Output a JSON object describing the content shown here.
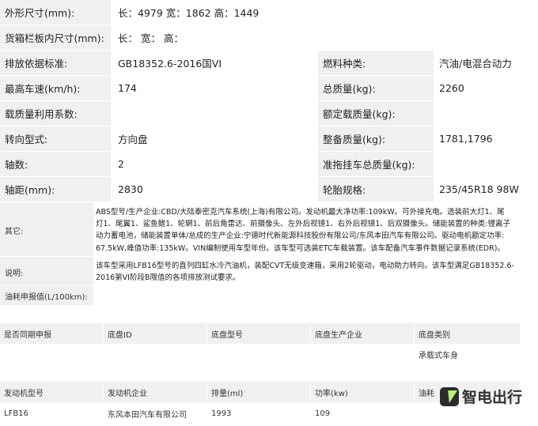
{
  "top": {
    "dimensions_label": "外形尺寸(mm):",
    "dimensions_value": "长：4979 宽：1862 高：1449",
    "cargo_label": "货箱栏板内尺寸(mm):",
    "cargo_value": "长：  宽：  高："
  },
  "rows": [
    {
      "l1": "排放依据标准:",
      "v1": "GB18352.6-2016国VI",
      "l2": "燃料种类:",
      "v2": "汽油/电混合动力"
    },
    {
      "l1": "最高车速(km/h):",
      "v1": "174",
      "l2": "总质量(kg):",
      "v2": "2260"
    },
    {
      "l1": "载质量利用系数:",
      "v1": "",
      "l2": "额定载质量(kg):",
      "v2": ""
    },
    {
      "l1": "转向型式:",
      "v1": "方向盘",
      "l2": "整备质量(kg):",
      "v2": "1781,1796"
    },
    {
      "l1": "轴数:",
      "v1": "2",
      "l2": "准拖挂车总质量(kg):",
      "v2": ""
    },
    {
      "l1": "轴距(mm):",
      "v1": "2830",
      "l2": "轮胎规格:",
      "v2": "235/45R18 98W"
    }
  ],
  "other": {
    "label": "其它:",
    "lines": [
      "ABS型号/生产企业:CBD/大陆泰密克汽车系统(上海)有限公司。发动机最大净功率:109kW。可外接充电。选装前大灯1、尾",
      "灯1、尾翼1、鲨鱼鳍1、轮辋1、前后角雷达、前摄像头、左外后视镜1、右外后视镜1、后双摄像头。储能装置的种类:锂离子",
      "动力蓄电池，储能装置单体/总成的生产企业:宁德时代新能源科技股份有限公司/东风本田汽车有限公司。驱动电机额定功率:",
      "67.5kW,峰值功率:135kW。VIN编制使用车型年份。该车型可选装ETC车载装置。该车配备汽车事件数据记录系统(EDR)。"
    ]
  },
  "note": {
    "label": "说明:",
    "lines": [
      "该车型采用LFB16型号的直列四缸水冷汽油机，装配CVT无级变速箱，采用2轮驱动，电动助力转向。该车型满足GB18352.6-",
      "2016第VI阶段B限值的各项排放测试要求。"
    ]
  },
  "fuel": {
    "label": "油耗申报值(L/100km):",
    "value": ""
  },
  "chassis": {
    "headers": [
      "是否同期申报",
      "底盘ID",
      "底盘型号",
      "底盘生产企业",
      "底盘类别"
    ],
    "row": [
      "",
      "",
      "",
      "",
      "承载式车身"
    ]
  },
  "engine": {
    "headers": [
      "发动机型号",
      "发动机企业",
      "排量(ml)",
      "功率(kw)",
      "油耗"
    ],
    "row": [
      "LFB16",
      "东风本田汽车有限公司",
      "1993",
      "109",
      ""
    ]
  },
  "watermark": {
    "text": "智电出行",
    "icon": "lightning-logo-icon"
  }
}
